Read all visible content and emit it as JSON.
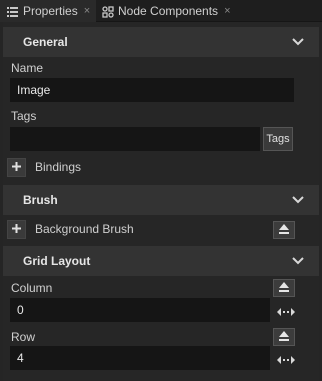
{
  "tabs": [
    {
      "label": "Properties",
      "icon": "list-icon",
      "close": "×"
    },
    {
      "label": "Node Components",
      "icon": "component-icon",
      "close": "×"
    }
  ],
  "general": {
    "title": "General",
    "name_label": "Name",
    "name_value": "Image",
    "tags_label": "Tags",
    "tags_value": "",
    "tags_button": "Tags",
    "bindings_label": "Bindings"
  },
  "brush": {
    "title": "Brush",
    "background_brush_label": "Background Brush"
  },
  "grid_layout": {
    "title": "Grid Layout",
    "column_label": "Column",
    "column_value": "0",
    "row_label": "Row",
    "row_value": "4"
  },
  "colors": {
    "background": "#252525",
    "section_header": "#333333",
    "field": "#151515"
  }
}
